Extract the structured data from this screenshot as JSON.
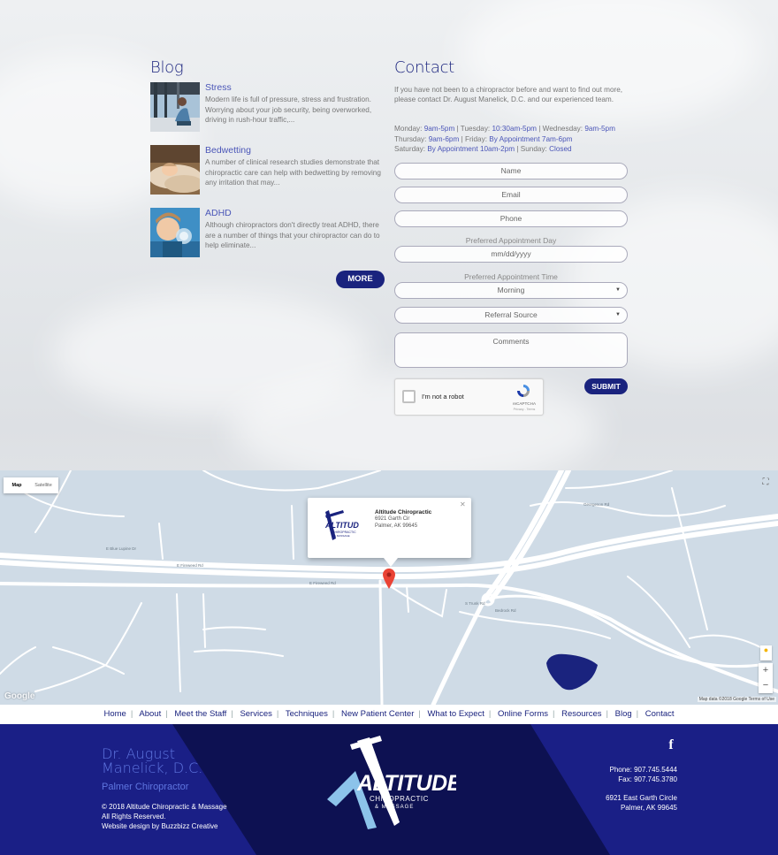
{
  "blog": {
    "heading": "Blog",
    "posts": [
      {
        "title": "Stress",
        "excerpt": "Modern life is full of pressure, stress and frustration. Worrying about your job security, being overworked, driving in rush-hour traffic,..."
      },
      {
        "title": "Bedwetting",
        "excerpt": "A number of clinical research studies demonstrate that chiropractic care can help with bedwetting by removing any irritation that may..."
      },
      {
        "title": "ADHD",
        "excerpt": "Although chiropractors don't directly treat ADHD, there are a number of things that your chiropractor can do to help eliminate..."
      }
    ],
    "more_label": "MORE"
  },
  "contact": {
    "heading": "Contact",
    "intro": "If you have not been to a chiropractor before and want to find out more, please contact Dr. August Manelick, D.C. and our experienced team.",
    "hours": {
      "mon_label": "Monday: ",
      "mon": "9am-5pm",
      "tue_label": " | Tuesday: ",
      "tue": "10:30am-5pm",
      "wed_label": " | Wednesday: ",
      "wed": "9am-5pm",
      "thu_label": "Thursday: ",
      "thu": "9am-6pm",
      "fri_label": " | Friday: ",
      "fri": "By Appointment 7am-6pm",
      "sat_label": "Saturday: ",
      "sat": "By Appointment 10am-2pm",
      "sun_label": " | Sunday: ",
      "sun": "Closed"
    },
    "name_placeholder": "Name",
    "email_placeholder": "Email",
    "phone_placeholder": "Phone",
    "day_label": "Preferred Appointment Day",
    "date_placeholder": "mm/dd/yyyy",
    "time_label": "Preferred Appointment Time",
    "time_value": "Morning",
    "referral_value": "Referral Source",
    "comments_placeholder": "Comments",
    "recaptcha_text": "I'm not a robot",
    "recaptcha_brand": "reCAPTCHA",
    "recaptcha_terms": "Privacy - Terms",
    "submit_label": "SUBMIT"
  },
  "map": {
    "type_map": "Map",
    "type_satellite": "Satellite",
    "info_name": "Altitude Chiropractic",
    "info_line1": "6921 Garth Cir",
    "info_line2": "Palmer, AK 99645",
    "google": "Google",
    "attribution": "Map data ©2018 Google   Terms of Use",
    "streets": [
      "E Fireweed Rd",
      "E Blue Lupine Dr",
      "S Trunk Rd",
      "Georgeson Rd",
      "Bedrock Rd"
    ]
  },
  "nav": {
    "items": [
      "Home",
      "About",
      "Meet the Staff",
      "Services",
      "Techniques",
      "New Patient Center",
      "What to Expect",
      "Online Forms",
      "Resources",
      "Blog",
      "Contact"
    ]
  },
  "footer": {
    "doctor": "Dr. August Manelick, D.C.",
    "subtitle": "Palmer Chiropractor",
    "copyright": "© 2018 Altitude Chiropractic & Massage",
    "rights": "All Rights Reserved.",
    "credit": "Website design by Buzzbizz Creative",
    "phone": "Phone: 907.745.5444",
    "fax": "Fax: 907.745.3780",
    "address1": "6921 East Garth Circle",
    "address2": "Palmer, AK 99645",
    "logo_main": "ALTITUDE",
    "logo_sub1": "CHIROPRACTIC",
    "logo_sub2": "& MASSAGE"
  },
  "colors": {
    "brand": "#1a237e",
    "accent": "#4b56b8",
    "footer_bg": "#1a1f86",
    "footer_dark": "#0d1152",
    "map_water": "#1a237e"
  }
}
